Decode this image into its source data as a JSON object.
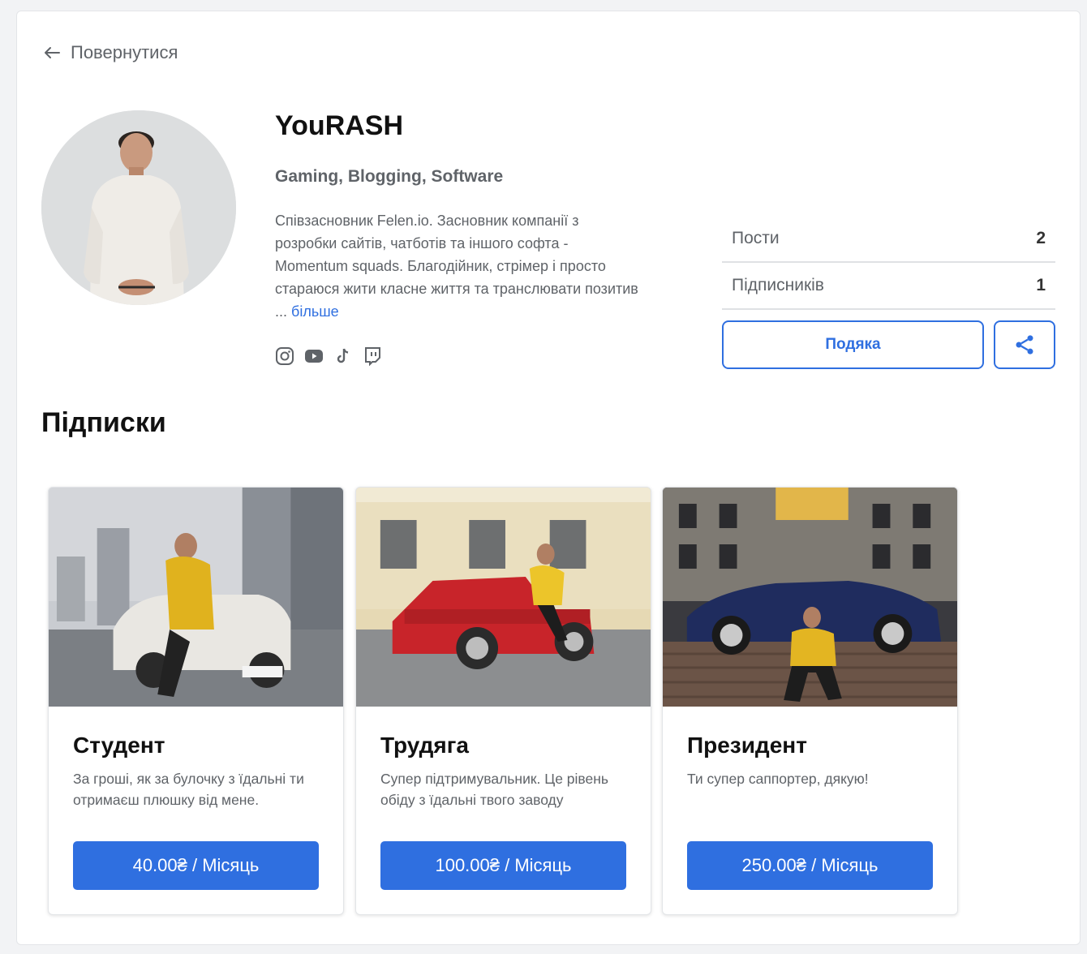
{
  "back": {
    "label": "Повернутися",
    "icon": "arrow-left-icon"
  },
  "profile": {
    "name": "YouRASH",
    "categories": "Gaming, Blogging, Software",
    "bio": "Співзасновник Felen.io. Засновник компанії з розробки сайтів, чатботів та іншого софта - Momentum squads. Благодійник, стрімер і просто стараюся жити класне життя та транслювати позитив ...",
    "more_label": "більше",
    "socials": [
      "instagram-icon",
      "youtube-icon",
      "tiktok-icon",
      "twitch-icon"
    ]
  },
  "stats": [
    {
      "label": "Пости",
      "value": "2"
    },
    {
      "label": "Підписників",
      "value": "1"
    }
  ],
  "actions": {
    "thanks_label": "Подяка",
    "share_icon": "share-icon"
  },
  "subscriptions": {
    "title": "Підписки",
    "tiers": [
      {
        "name": "Студент",
        "description": "За гроші, як за булочку з їдальні ти отримаєш плюшку від мене.",
        "price": "40.00₴ / Місяць"
      },
      {
        "name": "Трудяга",
        "description": "Супер підтримувальник. Це рівень обіду з їдальні твого заводу",
        "price": "100.00₴ / Місяць"
      },
      {
        "name": "Президент",
        "description": "Ти супер саппортер, дякую!",
        "price": "250.00₴ / Місяць"
      }
    ]
  },
  "colors": {
    "accent": "#2f6fe0",
    "muted_text": "#5f6368",
    "border": "#dfe1e4"
  }
}
